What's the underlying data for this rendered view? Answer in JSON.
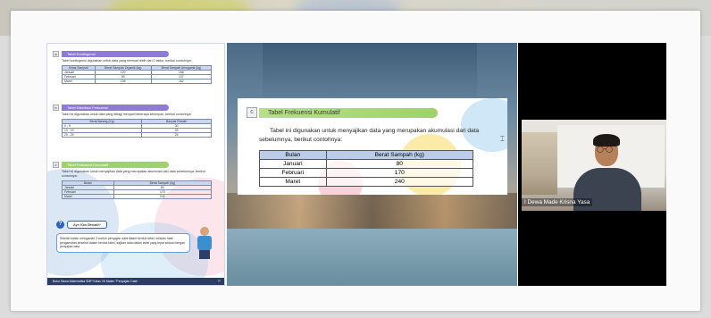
{
  "left_slide": {
    "section1": {
      "num": "a",
      "title": "Tabel Kontingensi",
      "desc": "Tabel kontingensi digunakan untuk data yang memuat lebih dari 2 faktor, berikut contohnya:",
      "headers": [
        "Kelas Sampah",
        "Berat Sampah Organik (kg)",
        "Berat Sampah Anorganik (kg)"
      ],
      "rows": [
        [
          "Januari",
          "120",
          "158"
        ],
        [
          "Februari",
          "89",
          "137"
        ],
        [
          "Maret",
          "106",
          "162"
        ]
      ]
    },
    "section2": {
      "num": "b",
      "title": "Tabel Distribusi Frekuensi",
      "desc": "Tabel ini digunakan untuk data yang dibagi menjadi beberapa kelompok, berikut contohnya:",
      "headers": [
        "Berat Barang (Kg)",
        "Banyak Rumah"
      ],
      "rows": [
        [
          "0 - 9",
          "30"
        ],
        [
          "10 - 19",
          "45"
        ],
        [
          "20 - 29",
          "25"
        ]
      ]
    },
    "section3": {
      "num": "c",
      "title": "Tabel Frekuensi Kumulatif",
      "desc": "Tabel ini digunakan untuk menyajikan data yang merupakan akumulasi dari data sebelumnya, berikut contohnya:",
      "headers": [
        "Bulan",
        "Berat Sampah (kg)"
      ],
      "rows": [
        [
          "Januari",
          "80"
        ],
        [
          "Februari",
          "170"
        ],
        [
          "Maret",
          "240"
        ]
      ]
    },
    "ayo": {
      "label": "Ayo Kita Berlatih!",
      "text": "Setelah kalian mengamati 3 contoh penyajian data dalam bentuk tabel, tuliskan hasil pengamatan tersebut dalam bentuk tabel, sajikan data dalam tabel yang tepat sesuai dengan penyajian data."
    },
    "footer": "Buku Siswa Matematika SMP Kelas VII Materi \"Penyajian Data\""
  },
  "center_slide": {
    "num": "c",
    "title": "Tabel Frekuensi Kumulatif",
    "desc": "Tabel ini digunakan untuk menyajikan data yang merupakan akumulasi dari data sebelumnya, berikut contohnya:",
    "headers": [
      "Bulan",
      "Berat Sampah (kg)"
    ],
    "rows": [
      [
        "Januari",
        "80"
      ],
      [
        "Februari",
        "170"
      ],
      [
        "Maret",
        "240"
      ]
    ]
  },
  "video": {
    "participant_name": "I Dewa Made Krisna Yasa"
  }
}
